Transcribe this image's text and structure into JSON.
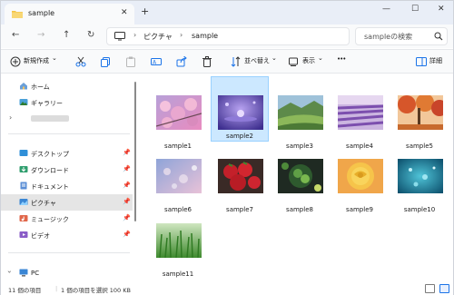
{
  "window": {
    "tab_title": "sample",
    "close_glyph": "✕",
    "new_tab_glyph": "+",
    "minimize_glyph": "—",
    "maximize_glyph": "☐",
    "window_close_glyph": "✕"
  },
  "nav": {
    "back_glyph": "←",
    "forward_glyph": "→",
    "up_glyph": "↑",
    "refresh_glyph": "↻",
    "separator_glyph": "›",
    "breadcrumb": [
      "ピクチャ",
      "sample"
    ],
    "search_placeholder": "sampleの検索"
  },
  "toolbar": {
    "new_label": "新規作成",
    "dropdown_glyph": "⌄",
    "sort_label": "並べ替え",
    "view_label": "表示",
    "more_glyph": "•••",
    "details_label": "詳細"
  },
  "sidebar": {
    "items": [
      {
        "label": "ホーム",
        "icon": "home-icon"
      },
      {
        "label": "ギャラリー",
        "icon": "gallery-icon"
      },
      {
        "label": "",
        "icon": "chevron-right-icon"
      },
      {
        "label": "デスクトップ",
        "icon": "desktop-folder-icon",
        "pinned": true
      },
      {
        "label": "ダウンロード",
        "icon": "download-folder-icon",
        "pinned": true
      },
      {
        "label": "ドキュメント",
        "icon": "documents-folder-icon",
        "pinned": true
      },
      {
        "label": "ピクチャ",
        "icon": "pictures-folder-icon",
        "pinned": true,
        "selected": true
      },
      {
        "label": "ミュージック",
        "icon": "music-folder-icon",
        "pinned": true
      },
      {
        "label": "ビデオ",
        "icon": "videos-folder-icon",
        "pinned": true
      },
      {
        "label": "PC",
        "icon": "pc-icon"
      }
    ],
    "pin_glyph": "📌",
    "expand_glyph": "›"
  },
  "files": [
    {
      "name": "sample1",
      "thumb": "cherry-blossom"
    },
    {
      "name": "sample2",
      "thumb": "purple-water",
      "selected": true
    },
    {
      "name": "sample3",
      "thumb": "green-valley"
    },
    {
      "name": "sample4",
      "thumb": "lavender-field"
    },
    {
      "name": "sample5",
      "thumb": "autumn-trees"
    },
    {
      "name": "sample6",
      "thumb": "bokeh"
    },
    {
      "name": "sample7",
      "thumb": "strawberries"
    },
    {
      "name": "sample8",
      "thumb": "green-vegetables"
    },
    {
      "name": "sample9",
      "thumb": "yellow-rose"
    },
    {
      "name": "sample10",
      "thumb": "teal-water"
    },
    {
      "name": "sample11",
      "thumb": "grass"
    }
  ],
  "status": {
    "item_count": "11 個の項目",
    "selection": "1 個の項目を選択  100 KB"
  },
  "colors": {
    "accent": "#0078d4",
    "selection_bg": "#cce8ff",
    "folder_yellow": "#f3c343"
  }
}
